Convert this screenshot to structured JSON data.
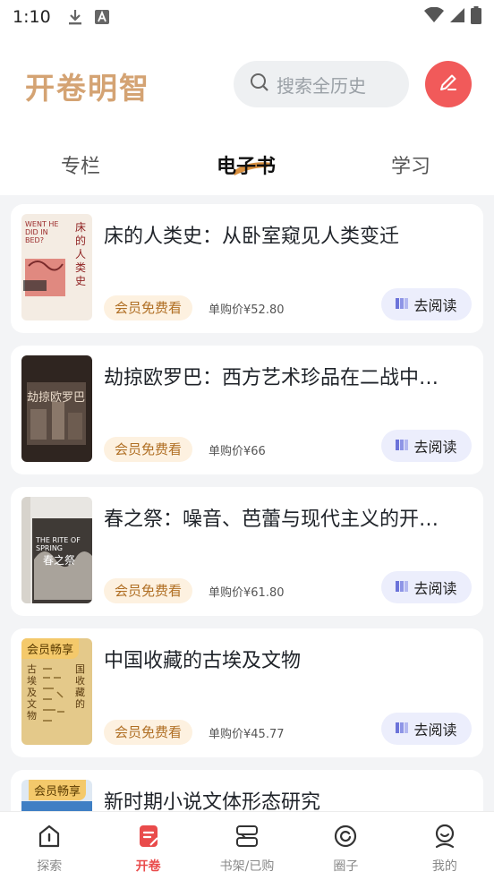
{
  "status": {
    "time": "1:10",
    "icons": [
      "download-icon",
      "text-a-icon",
      "wifi-icon",
      "signal-icon",
      "battery-icon"
    ]
  },
  "header": {
    "logo": "开卷明智",
    "search_placeholder": "搜索全历史",
    "edit_icon": "pen-icon"
  },
  "tabs": [
    {
      "label": "专栏",
      "active": false
    },
    {
      "label": "电子书",
      "active": true
    },
    {
      "label": "学习",
      "active": false
    }
  ],
  "books": [
    {
      "title": "床的人类史：从卧室窥见人类变迁",
      "badge": "会员免费看",
      "price": "单购价¥52.80",
      "read": "去阅读",
      "cover_text": "床的人类史",
      "cover_sub": "WENT HE DID IN BED?",
      "tag": ""
    },
    {
      "title": "劫掠欧罗巴：西方艺术珍品在二战中…",
      "badge": "会员免费看",
      "price": "单购价¥66",
      "read": "去阅读",
      "cover_text": "劫掠欧罗巴",
      "cover_sub": "",
      "tag": ""
    },
    {
      "title": "春之祭：噪音、芭蕾与现代主义的开…",
      "badge": "会员免费看",
      "price": "单购价¥61.80",
      "read": "去阅读",
      "cover_text": "春之祭",
      "cover_sub": "THE RITE OF SPRING",
      "tag": ""
    },
    {
      "title": "中国收藏的古埃及文物",
      "badge": "会员免费看",
      "price": "单购价¥45.77",
      "read": "去阅读",
      "cover_text": "古埃及文物",
      "cover_sub": "国收藏的",
      "tag": "会员畅享"
    },
    {
      "title": "新时期小说文体形态研究",
      "badge": "",
      "price": "",
      "read": "",
      "cover_text": "",
      "cover_sub": "",
      "tag": "会员畅享"
    }
  ],
  "nav": [
    {
      "label": "探索",
      "icon": "explore-icon",
      "active": false
    },
    {
      "label": "开卷",
      "icon": "open-book-icon",
      "active": true
    },
    {
      "label": "书架/已购",
      "icon": "bookshelf-icon",
      "active": false
    },
    {
      "label": "圈子",
      "icon": "circle-icon",
      "active": false
    },
    {
      "label": "我的",
      "icon": "profile-icon",
      "active": false
    }
  ],
  "colors": {
    "accent": "#e94b4b",
    "logo": "#d4a373",
    "badge_bg": "#fdf1e0",
    "badge_text": "#b06f24",
    "read_bg": "#eceefc"
  }
}
